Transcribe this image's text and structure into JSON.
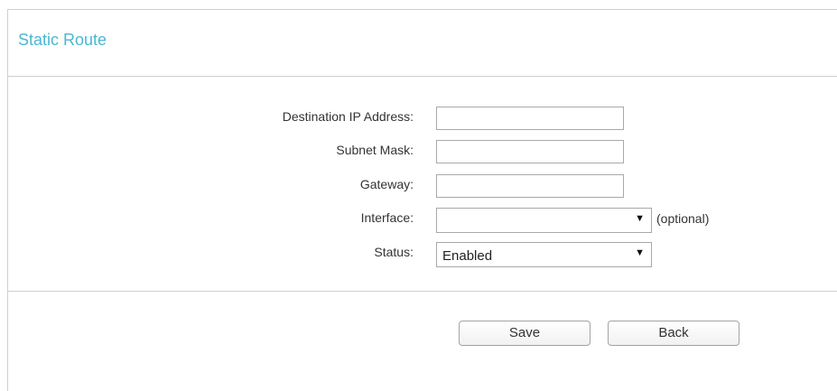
{
  "page": {
    "title": "Static Route"
  },
  "form": {
    "destination_label": "Destination IP Address:",
    "destination_value": "",
    "subnet_label": "Subnet Mask:",
    "subnet_value": "",
    "gateway_label": "Gateway:",
    "gateway_value": "",
    "interface_label": "Interface:",
    "interface_value": "",
    "interface_hint": "(optional)",
    "status_label": "Status:",
    "status_value": "Enabled"
  },
  "actions": {
    "save_label": "Save",
    "back_label": "Back"
  },
  "icons": {
    "dropdown": "chevron-down-icon"
  },
  "colors": {
    "title": "#4ab7d3",
    "border": "#cfcfcf"
  }
}
